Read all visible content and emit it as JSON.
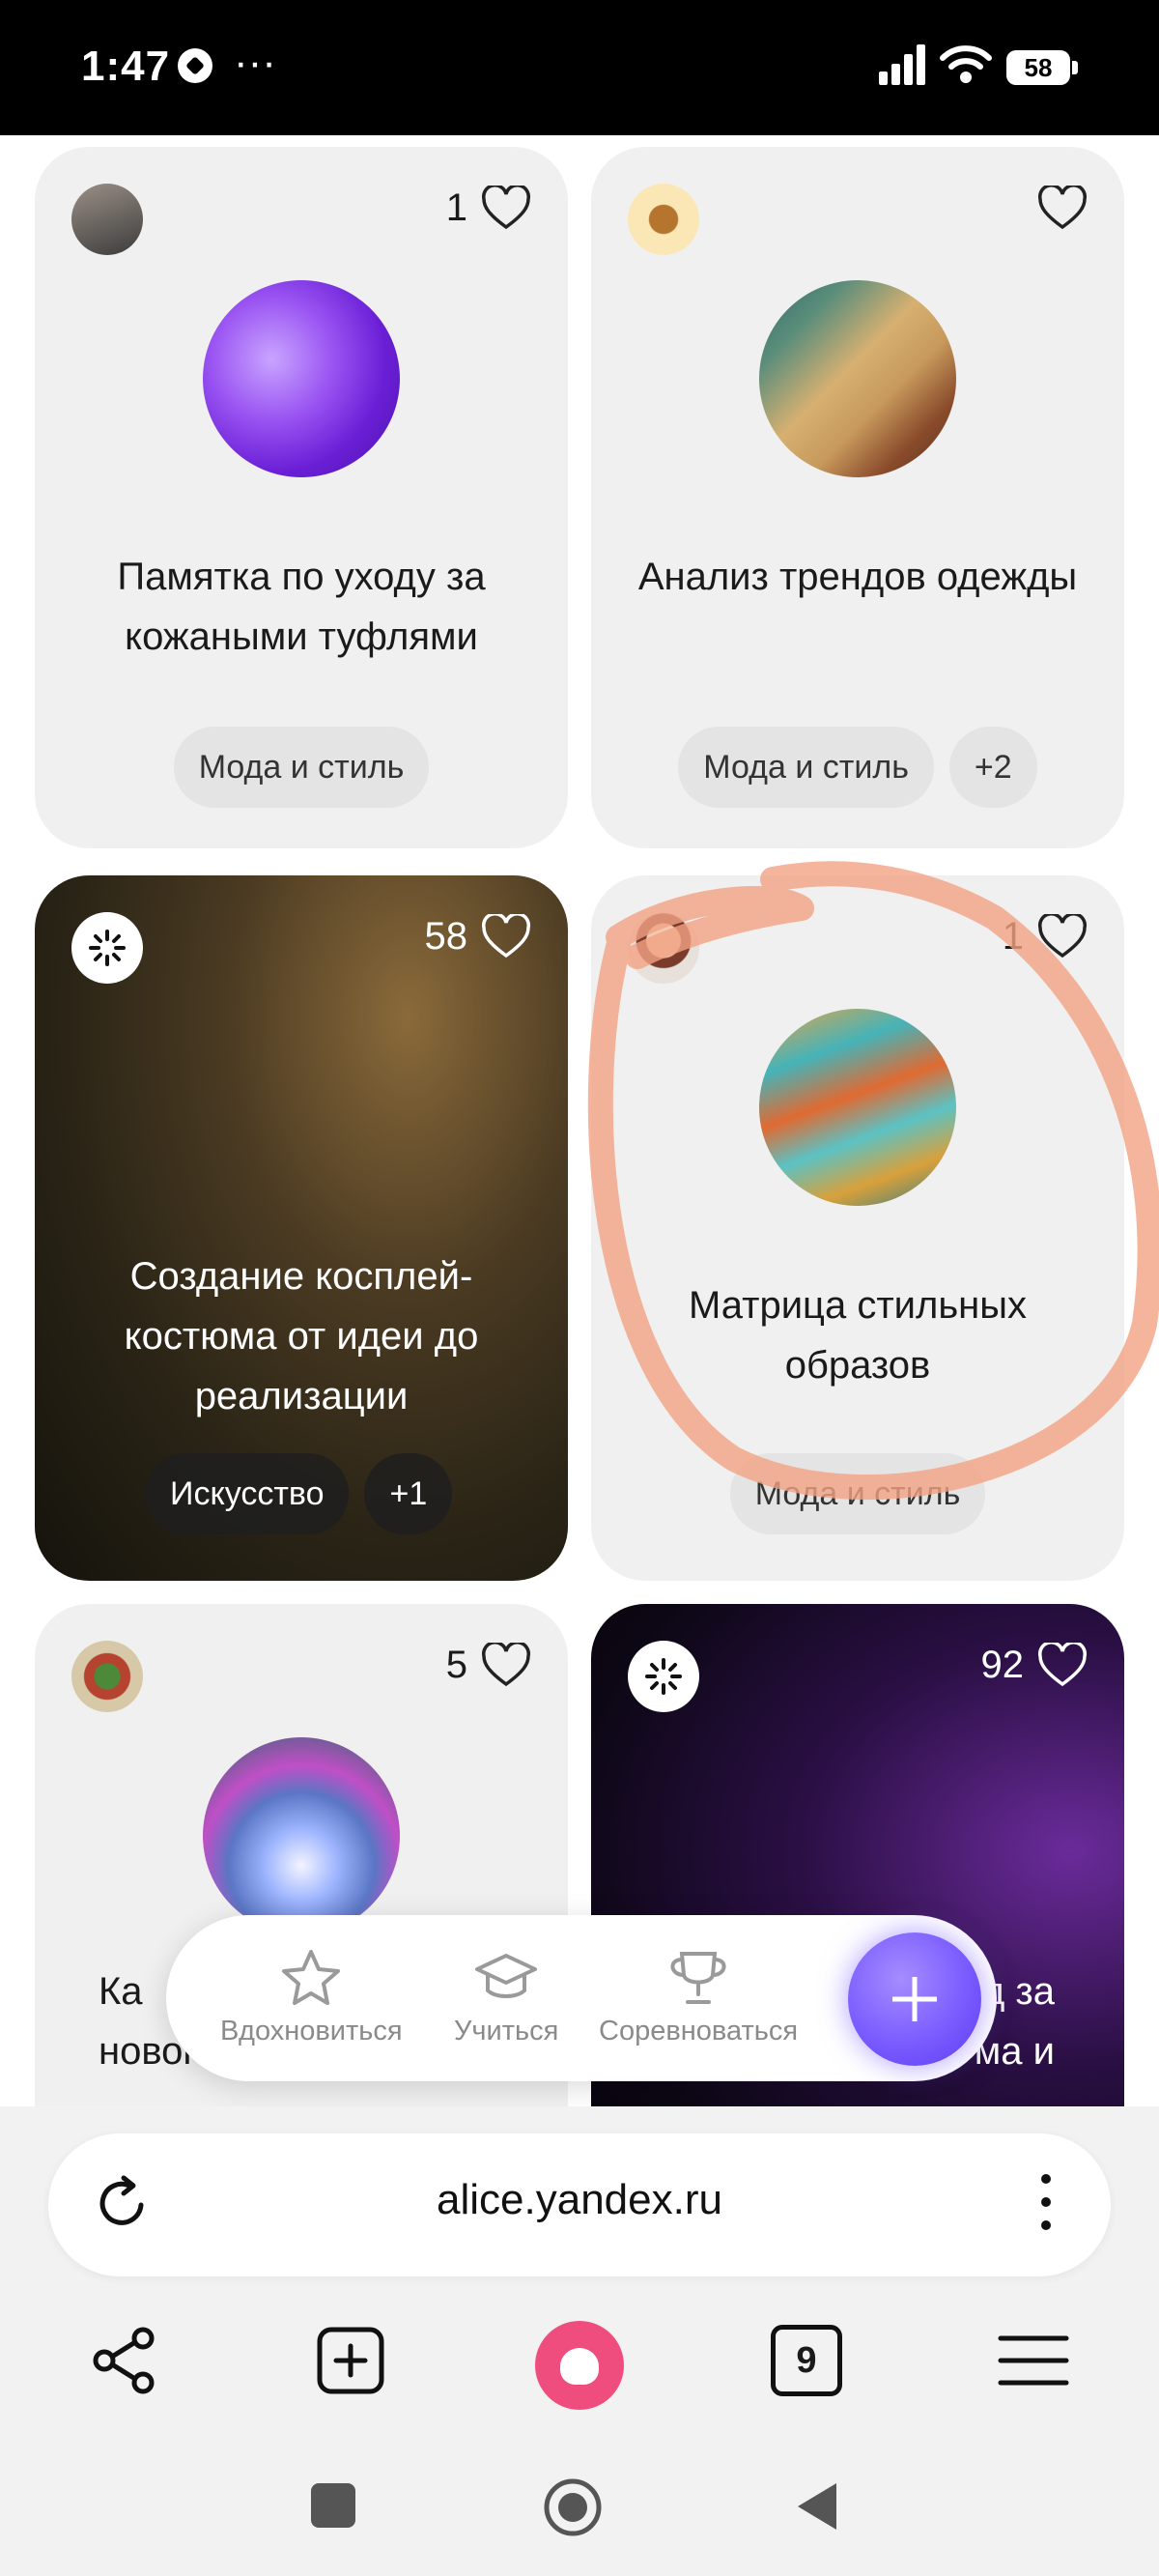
{
  "status_bar": {
    "time": "1:47",
    "more": "···",
    "battery": "58"
  },
  "cards": [
    {
      "likes": "1",
      "title": "Памятка по уходу за кожаными туфлями",
      "tags": [
        "Мода и стиль"
      ]
    },
    {
      "likes": "",
      "title": "Анализ трендов одежды",
      "tags": [
        "Мода и стиль",
        "+2"
      ]
    },
    {
      "likes": "58",
      "title": "Создание косплей-костюма от идеи до реализации",
      "tags": [
        "Искусство",
        "+1"
      ]
    },
    {
      "likes": "1",
      "title": "Матрица стильных образов",
      "tags": [
        "Мода и стиль"
      ]
    },
    {
      "likes": "5",
      "title_line1": "Ка",
      "title_line2": "нового"
    },
    {
      "likes": "92",
      "title_line1": "д за",
      "title_line2": "ма и"
    }
  ],
  "nav": {
    "inspire": "Вдохновиться",
    "learn": "Учиться",
    "compete": "Соревноваться"
  },
  "browser": {
    "url": "alice.yandex.ru",
    "tab_count": "9"
  },
  "colors": {
    "accent_purple": "#7a5cff",
    "alice_pink": "#ee4d7e",
    "annotation": "#f0a080"
  }
}
